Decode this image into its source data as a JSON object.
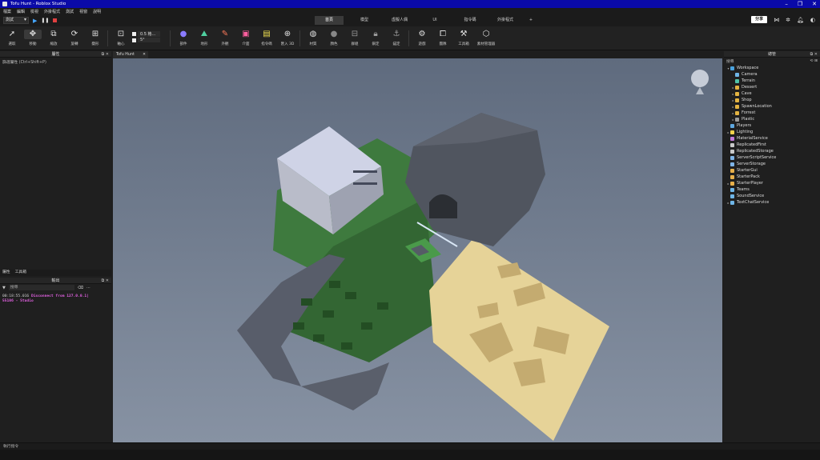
{
  "window": {
    "title": "Tofu Hunt - Roblox Studio",
    "min": "–",
    "max": "❐",
    "close": "✕"
  },
  "menu": [
    "檔案",
    "編輯",
    "檢視",
    "外掛程式",
    "測試",
    "視窗",
    "說明"
  ],
  "play": {
    "mode": "測試"
  },
  "ribbon_tabs": [
    "首頁",
    "模型",
    "虛擬人偶",
    "UI",
    "指令碼",
    "外掛程式",
    "+"
  ],
  "ribbon_active": "首頁",
  "share_label": "分享",
  "toolbar": {
    "select": "選取",
    "move": "移動",
    "scale": "縮放",
    "rotate": "旋轉",
    "transform": "變形",
    "pivot": "軸心",
    "snap_move": "0.5 格...",
    "snap_rotate": "5°",
    "part": "部件",
    "terrain": "地形",
    "color": "外觀",
    "ui": "介面",
    "script": "指令碼",
    "import3d": "匯入 3D",
    "material": "材質",
    "color2": "顏色",
    "group": "群組",
    "lock": "鎖定",
    "anchor": "錨定",
    "settings": "遊戲",
    "team": "團隊",
    "toolbox": "工具箱",
    "assets": "素材管理器"
  },
  "left_panel": {
    "title": "屬性",
    "filter": "篩選屬性 (Ctrl+Shift+P)"
  },
  "left_tabs": [
    "屬性",
    "工具箱"
  ],
  "output": {
    "title": "輸出",
    "search_placeholder": "搜尋",
    "log_time": "00:18:55.016",
    "log_error": "Disconnect from 127.0.0.1|",
    "log_rest": "55106  -  Studio"
  },
  "viewport_tab": "Tofu Hunt",
  "explorer": {
    "title": "總管",
    "filter": "搜尋",
    "items": [
      {
        "label": "Workspace",
        "depth": 0,
        "arrow": "▾",
        "color": "#4aa3df"
      },
      {
        "label": "Camera",
        "depth": 1,
        "arrow": "",
        "color": "#6fb6e8"
      },
      {
        "label": "Terrain",
        "depth": 1,
        "arrow": "",
        "color": "#4fc3a8"
      },
      {
        "label": "Dessert",
        "depth": 1,
        "arrow": "▸",
        "color": "#e3b341"
      },
      {
        "label": "Cave",
        "depth": 1,
        "arrow": "▸",
        "color": "#e3b341"
      },
      {
        "label": "Shop",
        "depth": 1,
        "arrow": "▸",
        "color": "#e3b341"
      },
      {
        "label": "SpawnLocation",
        "depth": 1,
        "arrow": "▸",
        "color": "#e3b341"
      },
      {
        "label": "Forrest",
        "depth": 1,
        "arrow": "▸",
        "color": "#e3b341"
      },
      {
        "label": "Plastic",
        "depth": 1,
        "arrow": "▸",
        "color": "#9a9a9a"
      },
      {
        "label": "Players",
        "depth": 0,
        "arrow": "",
        "color": "#5fa8e0"
      },
      {
        "label": "Lighting",
        "depth": 0,
        "arrow": "▸",
        "color": "#f2d24b"
      },
      {
        "label": "MaterialService",
        "depth": 0,
        "arrow": "",
        "color": "#c07ad9"
      },
      {
        "label": "ReplicatedFirst",
        "depth": 0,
        "arrow": "",
        "color": "#c9c9c9"
      },
      {
        "label": "ReplicatedStorage",
        "depth": 0,
        "arrow": "",
        "color": "#c9c9c9"
      },
      {
        "label": "ServerScriptService",
        "depth": 0,
        "arrow": "",
        "color": "#7fb4e6"
      },
      {
        "label": "ServerStorage",
        "depth": 0,
        "arrow": "",
        "color": "#7fb4e6"
      },
      {
        "label": "StarterGui",
        "depth": 0,
        "arrow": "",
        "color": "#e8b04a"
      },
      {
        "label": "StarterPack",
        "depth": 0,
        "arrow": "",
        "color": "#e8b04a"
      },
      {
        "label": "StarterPlayer",
        "depth": 0,
        "arrow": "▸",
        "color": "#e8b04a"
      },
      {
        "label": "Teams",
        "depth": 0,
        "arrow": "",
        "color": "#6fb6e8"
      },
      {
        "label": "SoundService",
        "depth": 0,
        "arrow": "",
        "color": "#6fb6e8"
      },
      {
        "label": "TextChatService",
        "depth": 0,
        "arrow": "▸",
        "color": "#6fb6e8"
      }
    ]
  },
  "statusbar": "執行指令"
}
